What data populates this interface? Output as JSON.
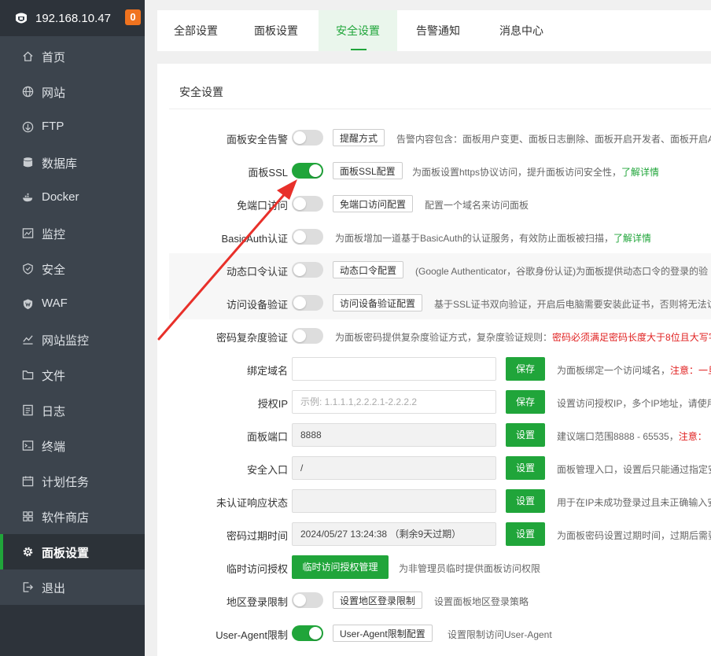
{
  "sidebar": {
    "ip": "192.168.10.47",
    "badge": "0",
    "items": [
      {
        "label": "首页",
        "icon": "home-icon"
      },
      {
        "label": "网站",
        "icon": "globe-icon"
      },
      {
        "label": "FTP",
        "icon": "ftp-icon"
      },
      {
        "label": "数据库",
        "icon": "database-icon"
      },
      {
        "label": "Docker",
        "icon": "docker-icon"
      },
      {
        "label": "监控",
        "icon": "monitor-icon"
      },
      {
        "label": "安全",
        "icon": "shield-icon"
      },
      {
        "label": "WAF",
        "icon": "waf-shield-icon"
      },
      {
        "label": "网站监控",
        "icon": "chart-line-icon"
      },
      {
        "label": "文件",
        "icon": "folder-icon"
      },
      {
        "label": "日志",
        "icon": "log-icon"
      },
      {
        "label": "终端",
        "icon": "terminal-icon"
      },
      {
        "label": "计划任务",
        "icon": "calendar-icon"
      },
      {
        "label": "软件商店",
        "icon": "apps-icon"
      },
      {
        "label": "面板设置",
        "icon": "gear-icon",
        "active": true
      },
      {
        "label": "退出",
        "icon": "logout-icon"
      }
    ]
  },
  "tabs": [
    "全部设置",
    "面板设置",
    "安全设置",
    "告警通知",
    "消息中心"
  ],
  "active_tab": "安全设置",
  "section_title": "安全设置",
  "settings": {
    "alarm": {
      "label": "面板安全告警",
      "toggle": false,
      "button": "提醒方式",
      "desc": "告警内容包含：面板用户变更、面板日志删除、面板开启开发者、面板开启A"
    },
    "ssl": {
      "label": "面板SSL",
      "toggle": true,
      "button": "面板SSL配置",
      "desc": "为面板设置https协议访问，提升面板访问安全性，",
      "link": "了解详情"
    },
    "no_port": {
      "label": "免端口访问",
      "toggle": false,
      "button": "免端口访问配置",
      "desc": "配置一个域名来访问面板"
    },
    "basic_auth": {
      "label": "BasicAuth认证",
      "toggle": false,
      "desc": "为面板增加一道基于BasicAuth的认证服务，有效防止面板被扫描，",
      "link": "了解详情"
    },
    "dynamic": {
      "label": "动态口令认证",
      "toggle": false,
      "button": "动态口令配置",
      "desc": "(Google Authenticator，谷歌身份认证)为面板提供动态口令的登录的验"
    },
    "device": {
      "label": "访问设备验证",
      "toggle": false,
      "button": "访问设备验证配置",
      "desc": "基于SSL证书双向验证，开启后电脑需要安装此证书，否则将无法访"
    },
    "pwd_complex": {
      "label": "密码复杂度验证",
      "toggle": false,
      "desc": "为面板密码提供复杂度验证方式，复杂度验证规则：",
      "red": "密码必须满足密码长度大于8位且大写字"
    },
    "domain": {
      "label": "绑定域名",
      "value": "",
      "button": "保存",
      "desc": "为面板绑定一个访问域名，",
      "red": "注意：一旦"
    },
    "auth_ip": {
      "label": "授权IP",
      "placeholder": "示例: 1.1.1.1,2.2.2.1-2.2.2.2",
      "button": "保存",
      "desc": "设置访问授权IP，多个IP地址，请使用"
    },
    "port": {
      "label": "面板端口",
      "value": "8888",
      "button": "设置",
      "desc": "建议端口范围8888 - 65535，",
      "red": "注意："
    },
    "entry": {
      "label": "安全入口",
      "value": "/",
      "button": "设置",
      "desc": "面板管理入口，设置后只能通过指定安"
    },
    "unauth": {
      "label": "未认证响应状态",
      "value": "",
      "button": "设置",
      "desc": "用于在IP未成功登录过且未正确输入安"
    },
    "pwd_expire": {
      "label": "密码过期时间",
      "value": "2024/05/27 13:24:38 （剩余9天过期）",
      "button": "设置",
      "desc": "为面板密码设置过期时间，过期后需要"
    },
    "temp_auth": {
      "label": "临时访问授权",
      "button": "临时访问授权管理",
      "desc": "为非管理员临时提供面板访问权限"
    },
    "region": {
      "label": "地区登录限制",
      "toggle": false,
      "button": "设置地区登录限制",
      "desc": "设置面板地区登录策略"
    },
    "ua": {
      "label": "User-Agent限制",
      "toggle": true,
      "button": "User-Agent限制配置",
      "desc": "设置限制访问User-Agent"
    }
  },
  "colors": {
    "accent": "#20a53a",
    "sidebar": "#3c444d",
    "badge": "#f0731f",
    "arrow": "#e8302a"
  }
}
